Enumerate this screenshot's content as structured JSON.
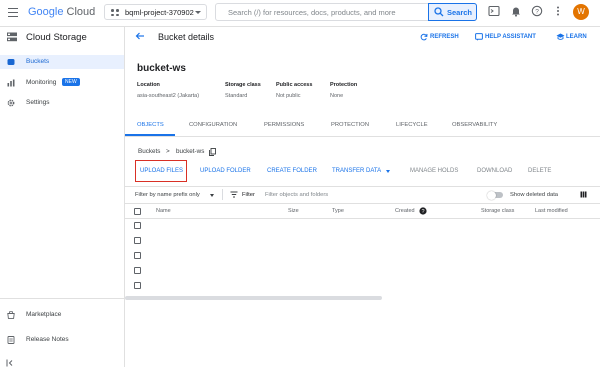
{
  "topbar": {
    "logo_google": "Google",
    "logo_cloud": "Cloud",
    "project": "bqml-project-370902",
    "search_placeholder": "Search (/) for resources, docs, products, and more",
    "search_button": "Search",
    "avatar_initial": "W"
  },
  "sidebar": {
    "title": "Cloud Storage",
    "items": [
      {
        "label": "Buckets"
      },
      {
        "label": "Monitoring",
        "badge": "NEW"
      },
      {
        "label": "Settings"
      }
    ],
    "bottom_items": [
      {
        "label": "Marketplace"
      },
      {
        "label": "Release Notes"
      }
    ]
  },
  "header": {
    "title": "Bucket details",
    "refresh": "REFRESH",
    "help": "HELP ASSISTANT",
    "learn": "LEARN"
  },
  "bucket": {
    "name": "bucket-ws",
    "meta": [
      {
        "label": "Location",
        "value": "asia-southeast2 (Jakarta)"
      },
      {
        "label": "Storage class",
        "value": "Standard"
      },
      {
        "label": "Public access",
        "value": "Not public"
      },
      {
        "label": "Protection",
        "value": "None"
      }
    ]
  },
  "tabs": [
    "OBJECTS",
    "CONFIGURATION",
    "PERMISSIONS",
    "PROTECTION",
    "LIFECYCLE",
    "OBSERVABILITY"
  ],
  "breadcrumb": {
    "root": "Buckets",
    "sep": ">",
    "current": "bucket-ws"
  },
  "actions": {
    "upload_files": "UPLOAD FILES",
    "upload_folder": "UPLOAD FOLDER",
    "create_folder": "CREATE FOLDER",
    "transfer_data": "TRANSFER DATA",
    "manage_holds": "MANAGE HOLDS",
    "download": "DOWNLOAD",
    "delete": "DELETE"
  },
  "filter": {
    "prefix": "Filter by name prefix only",
    "filter_label": "Filter",
    "placeholder": "Filter objects and folders",
    "show_deleted": "Show deleted data"
  },
  "table": {
    "columns": [
      "Name",
      "Size",
      "Type",
      "Created",
      "Storage class",
      "Last modified"
    ],
    "row_count": 5
  },
  "colors": {
    "accent": "#1a73e8",
    "highlight_box": "#d93025",
    "avatar": "#e37400"
  }
}
